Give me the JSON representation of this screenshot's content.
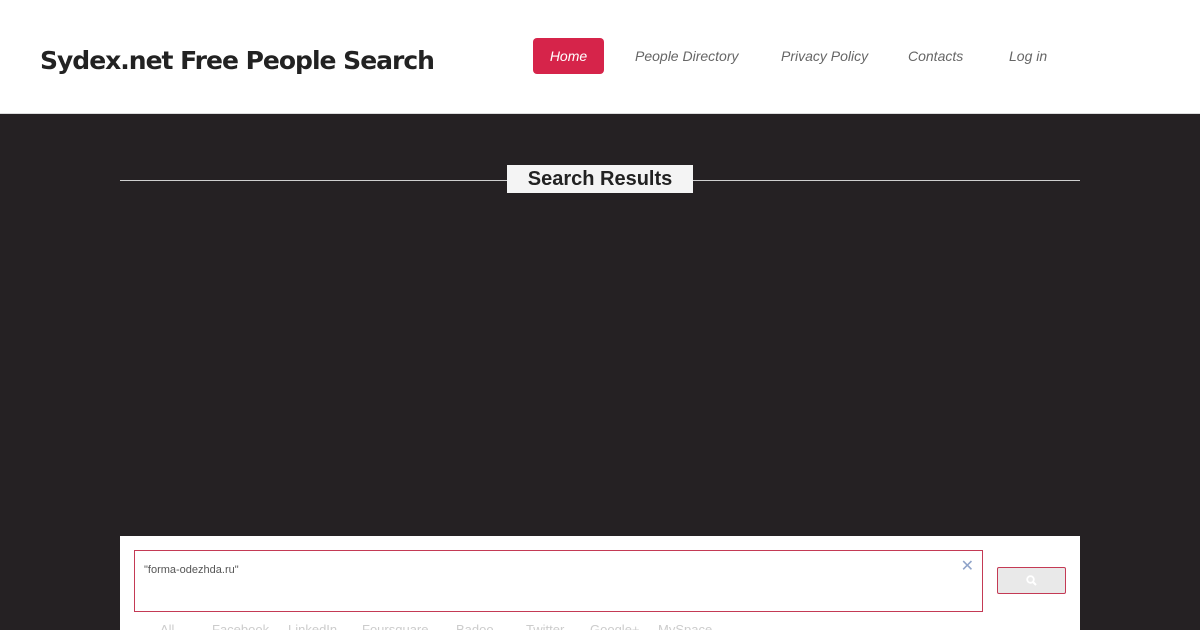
{
  "header": {
    "site_title": "Sydex.net Free People Search",
    "nav": [
      {
        "label": "Home",
        "active": true
      },
      {
        "label": "People Directory",
        "active": false
      },
      {
        "label": "Privacy Policy",
        "active": false
      },
      {
        "label": "Contacts",
        "active": false
      },
      {
        "label": "Log in",
        "active": false
      }
    ]
  },
  "main": {
    "title": "Search Results"
  },
  "search": {
    "query": "\"forma-odezhda.ru\"",
    "clear_icon": "close-icon",
    "button_icon": "search-icon",
    "tabs": [
      "All",
      "Facebook",
      "LinkedIn",
      "Foursquare",
      "Badoo",
      "Twitter",
      "Google+",
      "MySpace"
    ]
  },
  "colors": {
    "accent": "#d6244a",
    "background": "#252123",
    "header_background": "#ffffff",
    "search_border": "#c43a55"
  }
}
